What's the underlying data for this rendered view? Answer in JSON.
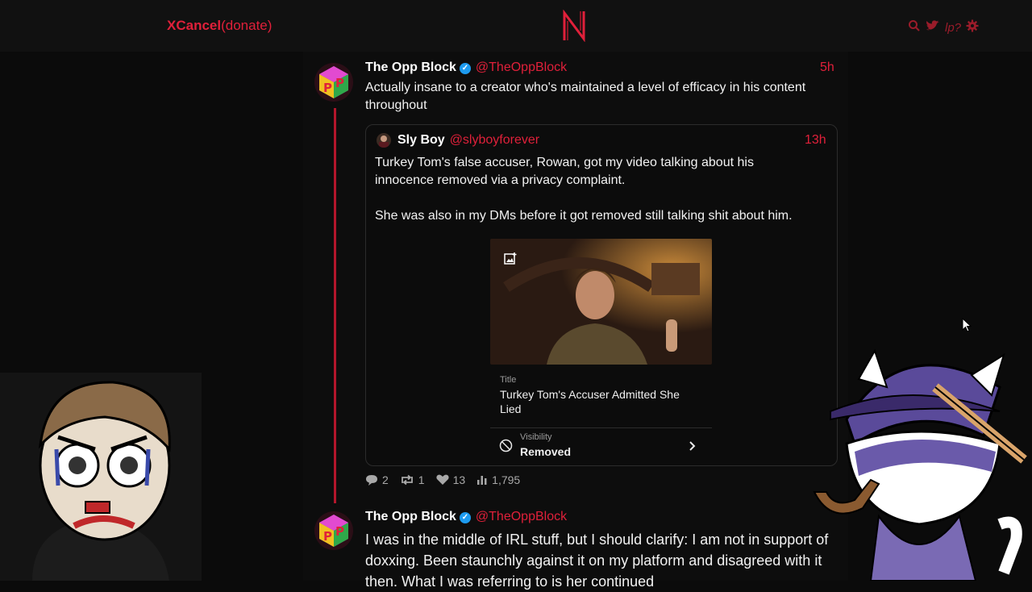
{
  "header": {
    "brand": "XCancel",
    "donate": "(donate)",
    "logo_letter": "N",
    "icons": [
      "search-icon",
      "bird-icon",
      "lp?",
      "gear-icon"
    ],
    "lp_label": "lp?"
  },
  "tweet1": {
    "name": "The Opp Block",
    "handle": "@TheOppBlock",
    "time": "5h",
    "text": "Actually insane to a creator who's maintained a level of efficacy in his content throughout",
    "quote": {
      "name": "Sly Boy",
      "handle": "@slyboyforever",
      "time": "13h",
      "para1": "Turkey Tom's false accuser, Rowan, got my video talking about his innocence removed via a privacy complaint.",
      "para2": "She was also in my DMs before it got removed still talking shit about him.",
      "card": {
        "title_label": "Title",
        "title": "Turkey Tom's Accuser Admitted She Lied",
        "visibility_label": "Visibility",
        "visibility": "Removed"
      }
    },
    "stats": {
      "replies": "2",
      "retweets": "1",
      "likes": "13",
      "views": "1,795"
    }
  },
  "tweet2": {
    "name": "The Opp Block",
    "handle": "@TheOppBlock",
    "text": "I was in the middle of IRL stuff, but I should clarify: I am not in support of doxxing. Been staunchly against it on my platform and disagreed with it then. What I was referring to is her continued"
  },
  "colors": {
    "accent": "#e0203a",
    "background": "#0b0b0b",
    "verified": "#1d9bf0"
  }
}
